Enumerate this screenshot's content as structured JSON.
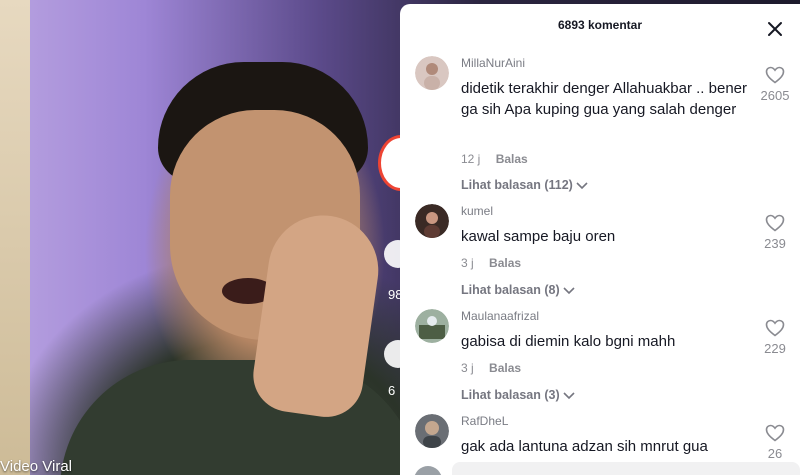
{
  "video": {
    "caption": "Video Viral",
    "side_counts": [
      "98",
      "6"
    ]
  },
  "panel": {
    "title": "6893 komentar"
  },
  "comments": [
    {
      "user": "MillaNurAini",
      "text": "didetik terakhir denger Allahuakbar .. bener ga sih Apa kuping gua yang salah denger",
      "time": "12 j",
      "reply_label": "Balas",
      "replies": "Lihat balasan (112)",
      "likes": "2605",
      "avatar_color": "#d9c7c1"
    },
    {
      "user": "kumel",
      "text": "kawal sampe baju oren",
      "time": "3 j",
      "reply_label": "Balas",
      "replies": "Lihat balasan (8)",
      "likes": "239",
      "avatar_color": "#3a2a25"
    },
    {
      "user": "Maulanaafrizal",
      "text": "gabisa di diemin kalo bgni mahh",
      "time": "3 j",
      "reply_label": "Balas",
      "replies": "Lihat balasan (3)",
      "likes": "229",
      "avatar_color": "#5b6b55"
    },
    {
      "user": "RafDheL",
      "text": "gak ada lantuna adzan sih mnrut gua",
      "likes": "26",
      "avatar_color": "#6a6e74"
    }
  ]
}
